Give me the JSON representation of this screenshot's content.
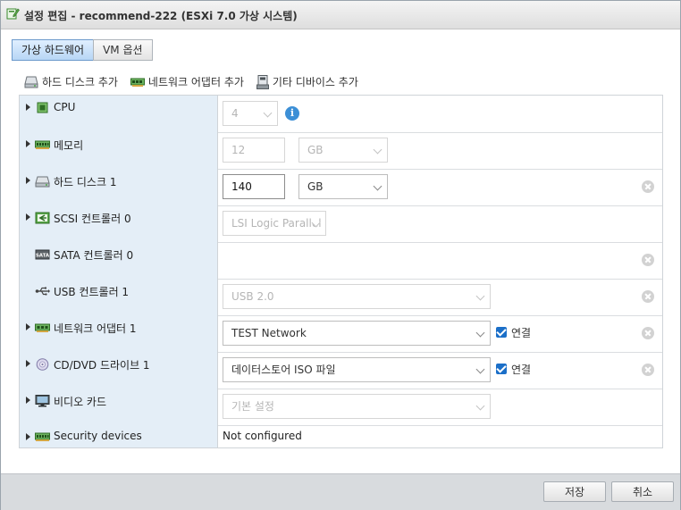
{
  "window": {
    "title": "설정 편집 - recommend-222 (ESXi 7.0 가상 시스템)"
  },
  "tabs": [
    {
      "label": "가상 하드웨어",
      "active": true
    },
    {
      "label": "VM 옵션",
      "active": false
    }
  ],
  "add_actions": {
    "hard_disk": "하드 디스크 추가",
    "network_adapter": "네트워크 어댑터 추가",
    "other_device": "기타 디바이스 추가"
  },
  "hardware": {
    "cpu": {
      "label": "CPU",
      "value": "4",
      "icon": "cpu-chip-icon"
    },
    "memory": {
      "label": "메모리",
      "value": "12",
      "unit": "GB",
      "icon": "memory-icon"
    },
    "hard_disk": {
      "label": "하드 디스크 1",
      "value": "140",
      "unit": "GB",
      "icon": "hard-disk-icon"
    },
    "scsi": {
      "label": "SCSI 컨트롤러 0",
      "value": "LSI Logic Parallel",
      "icon": "scsi-icon"
    },
    "sata": {
      "label": "SATA 컨트롤러 0",
      "icon": "sata-icon"
    },
    "usb": {
      "label": "USB 컨트롤러 1",
      "value": "USB 2.0",
      "icon": "usb-icon"
    },
    "network": {
      "label": "네트워크 어댑터 1",
      "value": "TEST Network",
      "connect_label": "연결",
      "connected": true,
      "icon": "network-adapter-icon"
    },
    "cddvd": {
      "label": "CD/DVD 드라이브 1",
      "value": "데이터스토어 ISO 파일",
      "connect_label": "연결",
      "connected": true,
      "icon": "cd-dvd-icon"
    },
    "video": {
      "label": "비디오 카드",
      "value": "기본 설정",
      "icon": "video-card-icon"
    },
    "security": {
      "label": "Security devices",
      "value": "Not configured",
      "icon": "security-device-icon"
    }
  },
  "footer": {
    "save": "저장",
    "cancel": "취소"
  },
  "colors": {
    "accent": "#1b6fc8",
    "label_bg": "#e4eef7",
    "active_tab": "#b7d6f5",
    "footer_bg": "#d8dbde"
  }
}
